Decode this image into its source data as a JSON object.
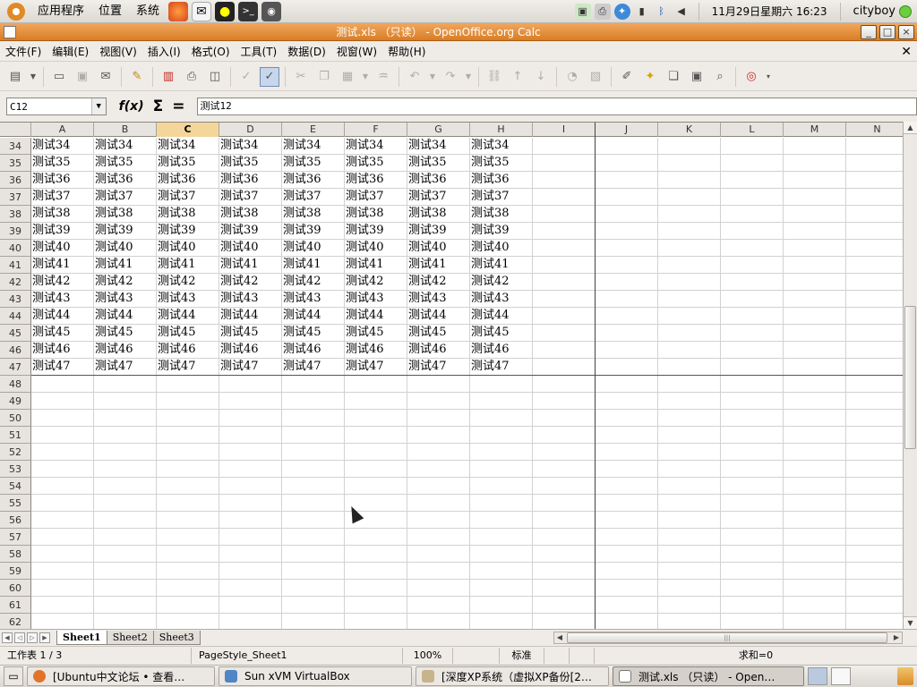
{
  "top_panel": {
    "menus": [
      "应用程序",
      "位置",
      "系统"
    ],
    "clock": "11月29日星期六 16:23",
    "user": "cityboy"
  },
  "window": {
    "title": "测试.xls  （只读） - OpenOffice.org Calc"
  },
  "menubar": [
    "文件(F)",
    "编辑(E)",
    "视图(V)",
    "插入(I)",
    "格式(O)",
    "工具(T)",
    "数据(D)",
    "视窗(W)",
    "帮助(H)"
  ],
  "formula_bar": {
    "name_box": "C12",
    "content": "测试12"
  },
  "sheet": {
    "columns": [
      "A",
      "B",
      "C",
      "D",
      "E",
      "F",
      "G",
      "H",
      "I",
      "J",
      "K",
      "L",
      "M",
      "N"
    ],
    "selected_column": "C",
    "rows": [
      {
        "num": "34",
        "cells": [
          "测试34",
          "测试34",
          "测试34",
          "测试34",
          "测试34",
          "测试34",
          "测试34",
          "测试34"
        ]
      },
      {
        "num": "35",
        "cells": [
          "测试35",
          "测试35",
          "测试35",
          "测试35",
          "测试35",
          "测试35",
          "测试35",
          "测试35"
        ]
      },
      {
        "num": "36",
        "cells": [
          "测试36",
          "测试36",
          "测试36",
          "测试36",
          "测试36",
          "测试36",
          "测试36",
          "测试36"
        ]
      },
      {
        "num": "37",
        "cells": [
          "测试37",
          "测试37",
          "测试37",
          "测试37",
          "测试37",
          "测试37",
          "测试37",
          "测试37"
        ]
      },
      {
        "num": "38",
        "cells": [
          "测试38",
          "测试38",
          "测试38",
          "测试38",
          "测试38",
          "测试38",
          "测试38",
          "测试38"
        ]
      },
      {
        "num": "39",
        "cells": [
          "测试39",
          "测试39",
          "测试39",
          "测试39",
          "测试39",
          "测试39",
          "测试39",
          "测试39"
        ]
      },
      {
        "num": "40",
        "cells": [
          "测试40",
          "测试40",
          "测试40",
          "测试40",
          "测试40",
          "测试40",
          "测试40",
          "测试40"
        ]
      },
      {
        "num": "41",
        "cells": [
          "测试41",
          "测试41",
          "测试41",
          "测试41",
          "测试41",
          "测试41",
          "测试41",
          "测试41"
        ]
      },
      {
        "num": "42",
        "cells": [
          "测试42",
          "测试42",
          "测试42",
          "测试42",
          "测试42",
          "测试42",
          "测试42",
          "测试42"
        ]
      },
      {
        "num": "43",
        "cells": [
          "测试43",
          "测试43",
          "测试43",
          "测试43",
          "测试43",
          "测试43",
          "测试43",
          "测试43"
        ]
      },
      {
        "num": "44",
        "cells": [
          "测试44",
          "测试44",
          "测试44",
          "测试44",
          "测试44",
          "测试44",
          "测试44",
          "测试44"
        ]
      },
      {
        "num": "45",
        "cells": [
          "测试45",
          "测试45",
          "测试45",
          "测试45",
          "测试45",
          "测试45",
          "测试45",
          "测试45"
        ]
      },
      {
        "num": "46",
        "cells": [
          "测试46",
          "测试46",
          "测试46",
          "测试46",
          "测试46",
          "测试46",
          "测试46",
          "测试46"
        ]
      },
      {
        "num": "47",
        "cells": [
          "测试47",
          "测试47",
          "测试47",
          "测试47",
          "测试47",
          "测试47",
          "测试47",
          "测试47"
        ]
      },
      {
        "num": "48",
        "cells": []
      },
      {
        "num": "49",
        "cells": []
      },
      {
        "num": "50",
        "cells": []
      },
      {
        "num": "51",
        "cells": []
      },
      {
        "num": "52",
        "cells": []
      },
      {
        "num": "53",
        "cells": []
      },
      {
        "num": "54",
        "cells": []
      },
      {
        "num": "55",
        "cells": []
      },
      {
        "num": "56",
        "cells": []
      },
      {
        "num": "57",
        "cells": []
      },
      {
        "num": "58",
        "cells": []
      },
      {
        "num": "59",
        "cells": []
      },
      {
        "num": "60",
        "cells": []
      },
      {
        "num": "61",
        "cells": []
      },
      {
        "num": "62",
        "cells": []
      }
    ],
    "tabs": [
      "Sheet1",
      "Sheet2",
      "Sheet3"
    ],
    "active_tab": "Sheet1"
  },
  "statusbar": {
    "sheet_pos": "工作表 1 / 3",
    "page_style": "PageStyle_Sheet1",
    "zoom": "100%",
    "mode": "标准",
    "sum": "求和=0"
  },
  "taskbar": {
    "tasks": [
      {
        "label": "[Ubuntu中文论坛 • 查看…",
        "icon_color": "#e2742a"
      },
      {
        "label": "Sun xVM VirtualBox",
        "icon_color": "#4f86c6"
      },
      {
        "label": "[深度XP系统（虚拟XP备份[2…",
        "icon_color": "#c8b48c"
      },
      {
        "label": "测试.xls （只读） - Open…",
        "icon_color": "#ffffff"
      }
    ]
  },
  "colors": {
    "titlebar": "#e08a32",
    "selected_header": "#f4d59a"
  }
}
